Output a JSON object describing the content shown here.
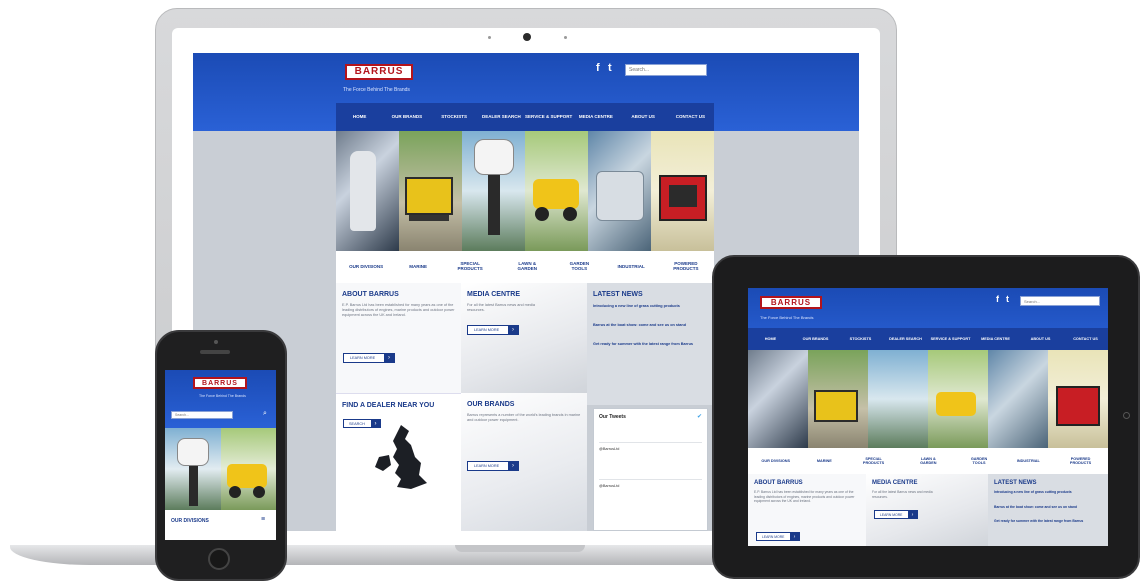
{
  "brand": {
    "logo": "BARRUS",
    "tagline": "The Force Behind The Brands"
  },
  "search": {
    "placeholder": "Search..."
  },
  "social": {
    "facebook": "f",
    "twitter": "t"
  },
  "nav": {
    "items": [
      "HOME",
      "OUR BRANDS",
      "STOCKISTS",
      "DEALER SEARCH",
      "SERVICE & SUPPORT",
      "MEDIA CENTRE",
      "ABOUT US",
      "CONTACT US"
    ]
  },
  "subnav": {
    "items": [
      "OUR DIVISIONS",
      "MARINE",
      "SPECIAL PRODUCTS",
      "LAWN & GARDEN",
      "GARDEN TOOLS",
      "INDUSTRIAL",
      "POWERED PRODUCTS"
    ]
  },
  "panels": {
    "about": {
      "title": "ABOUT BARRUS",
      "text": "E.P. Barrus Ltd has been established for many years as one of the leading distributors of engines, marine products and outdoor power equipment across the UK and Ireland.",
      "button": "LEARN MORE"
    },
    "media": {
      "title": "MEDIA CENTRE",
      "text": "For all the latest Barrus news and media resources.",
      "button": "LEARN MORE"
    },
    "news": {
      "title": "LATEST NEWS",
      "items": [
        "Introducing a new line of grass cutting products",
        "Barrus at the boat show: come and see us on stand",
        "Get ready for summer with the latest range from Barrus"
      ]
    },
    "dealer": {
      "title": "FIND A DEALER NEAR YOU",
      "button": "SEARCH"
    },
    "brands": {
      "title": "OUR BRANDS",
      "text": "Barrus represents a number of the world's leading brands in marine and outdoor power equipment.",
      "button": "LEARN MORE"
    },
    "tweets": {
      "title": "Our Tweets",
      "items": [
        "@BarrusLtd",
        "@BarrusLtd"
      ]
    }
  },
  "phone": {
    "search_placeholder": "Search...",
    "section": "OUR DIVISIONS"
  },
  "colors": {
    "header_blue": "#2a61d6",
    "nav_blue": "#1a3f9e",
    "brand_red": "#b3141c",
    "heading_blue": "#1a3a8a"
  }
}
